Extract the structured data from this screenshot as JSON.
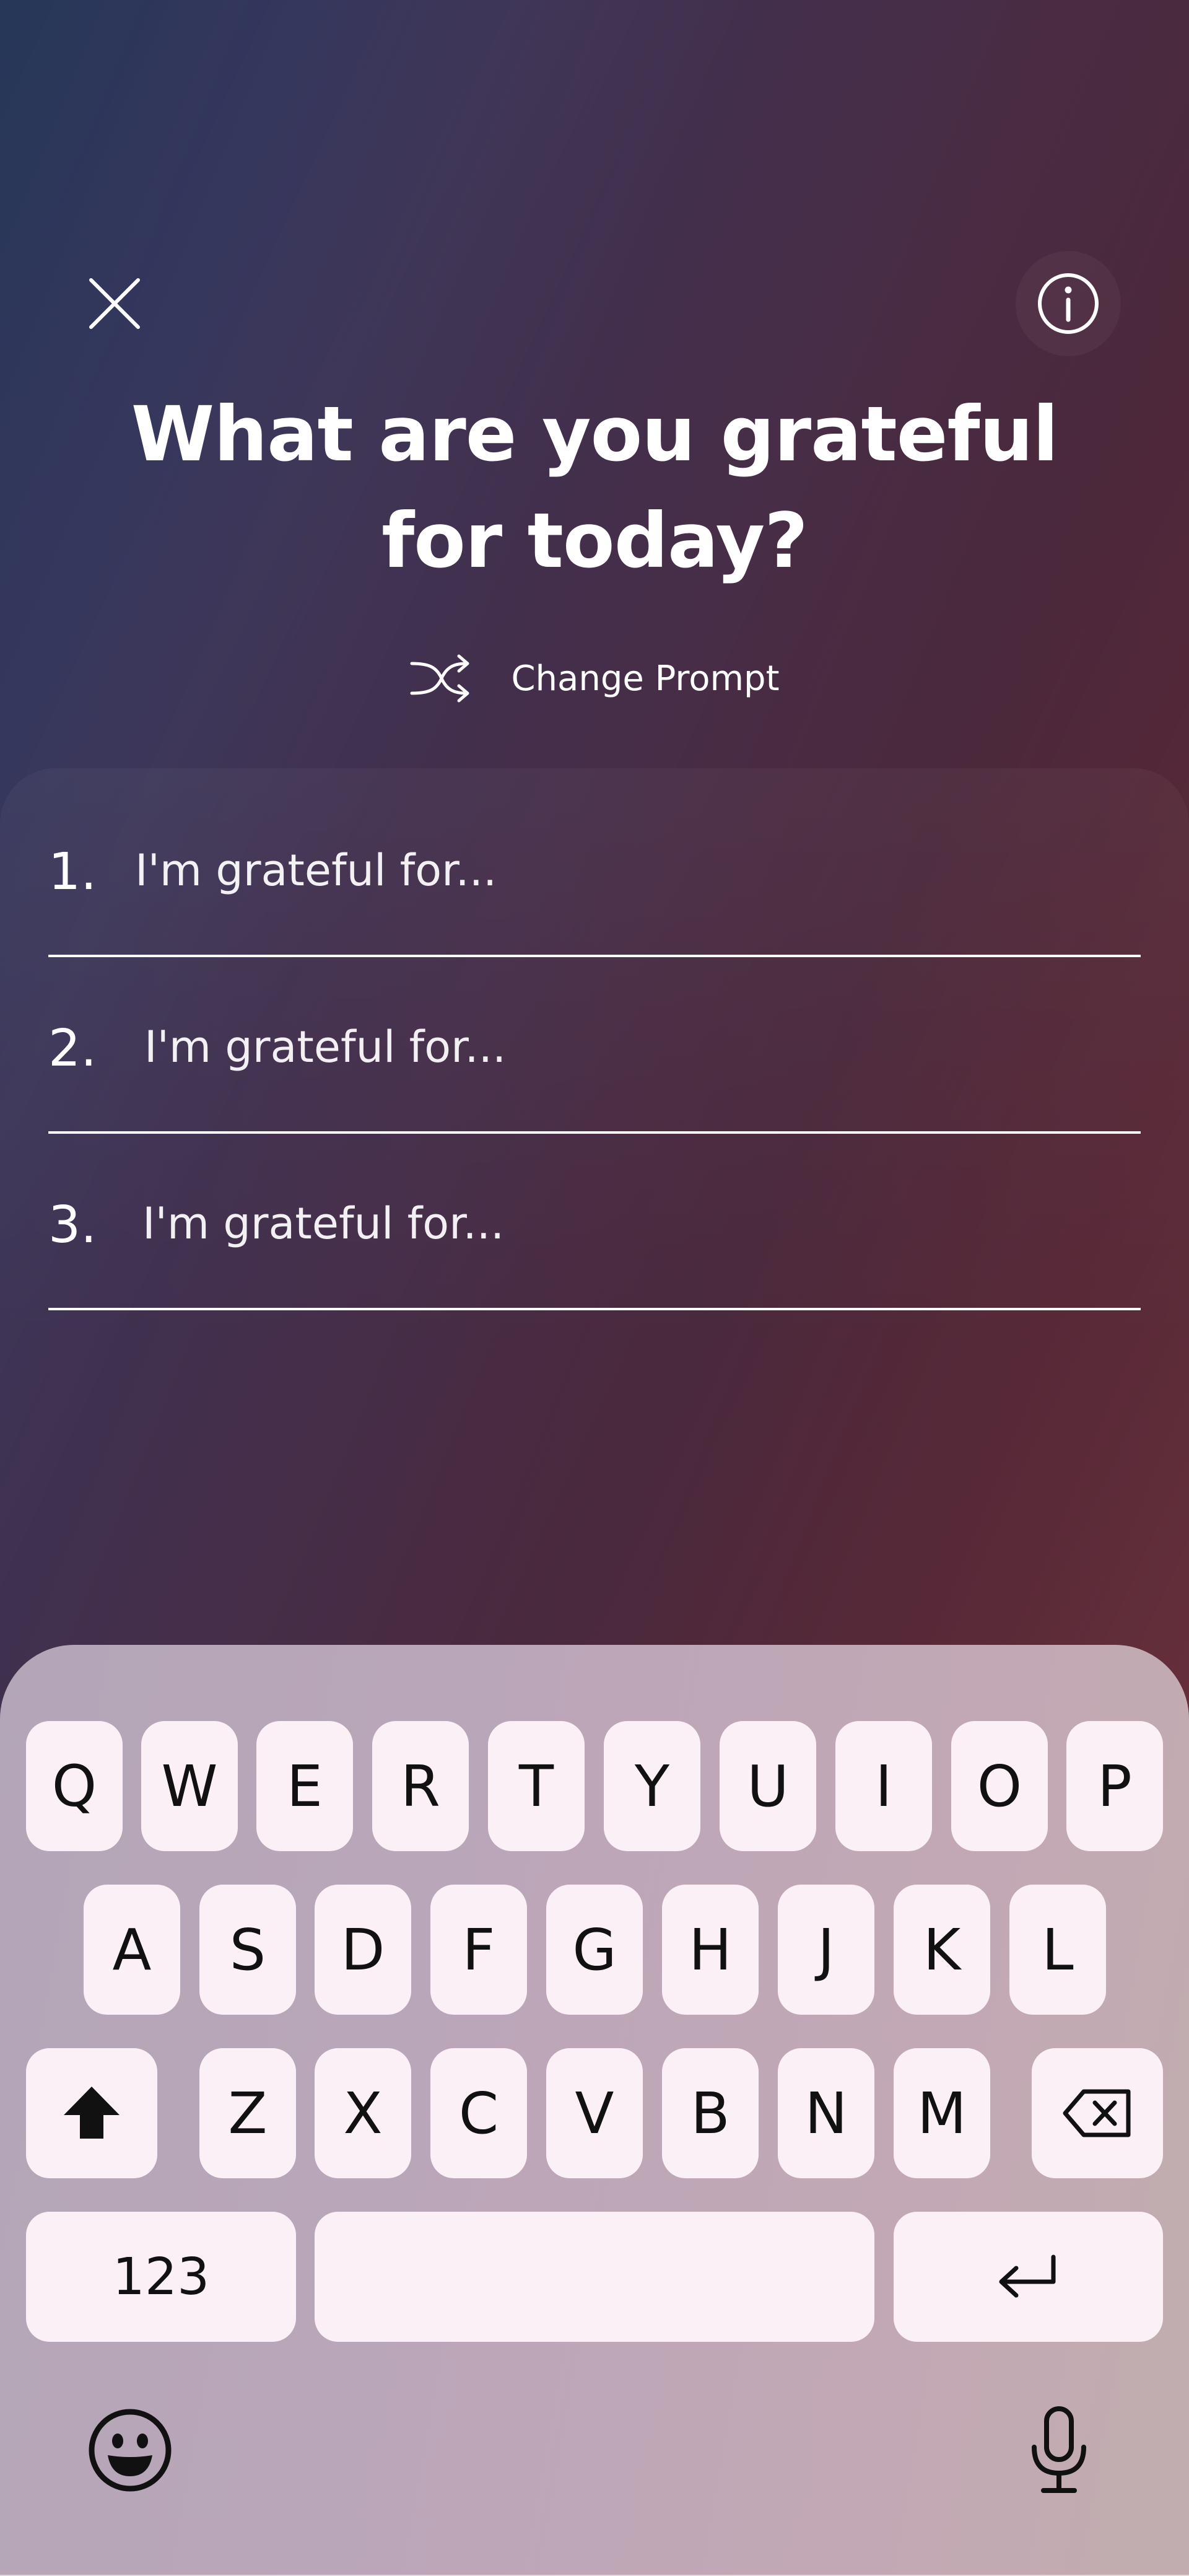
{
  "header": {
    "title_line1": "What are you grateful",
    "title_line2": "for today?",
    "close_icon": "close-icon",
    "info_icon": "info-icon"
  },
  "change_prompt": {
    "label": "Change Prompt",
    "icon": "shuffle-icon"
  },
  "entries": [
    {
      "number": "1.",
      "placeholder": "I'm grateful for..."
    },
    {
      "number": "2.",
      "placeholder": "I'm grateful for..."
    },
    {
      "number": "3.",
      "placeholder": "I'm grateful for..."
    }
  ],
  "keyboard": {
    "row1": [
      "Q",
      "W",
      "E",
      "R",
      "T",
      "Y",
      "U",
      "I",
      "O",
      "P"
    ],
    "row2": [
      "A",
      "S",
      "D",
      "F",
      "G",
      "H",
      "J",
      "K",
      "L"
    ],
    "row3": [
      "Z",
      "X",
      "C",
      "V",
      "B",
      "N",
      "M"
    ],
    "numbers_label": "123",
    "icons": [
      "shift-icon",
      "backspace-icon",
      "enter-icon",
      "emoji-icon",
      "microphone-icon"
    ]
  },
  "colors": {
    "background_start": "#263758",
    "background_end": "#652a33",
    "keyboard_bg": "#bba6b9",
    "key_bg": "#fbf0f6",
    "key_text": "#111111"
  }
}
